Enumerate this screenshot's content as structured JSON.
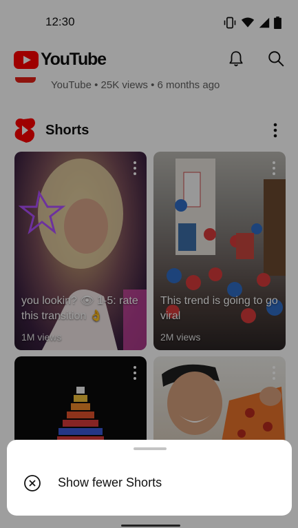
{
  "status_bar": {
    "time": "12:30",
    "icons": [
      "vibrate-icon",
      "wifi-icon",
      "signal-icon",
      "battery-icon"
    ]
  },
  "app_bar": {
    "logo_text": "YouTube",
    "brand_color": "#ff0000",
    "icons": [
      "notifications-bell-icon",
      "search-icon"
    ]
  },
  "previous_item": {
    "meta": "YouTube • 25K views • 6 months ago"
  },
  "shorts_shelf": {
    "title": "Shorts",
    "items": [
      {
        "caption": "you lookin? 👁 1-5: rate this transition 👌",
        "views": "1M views"
      },
      {
        "caption": "This trend is going to go viral",
        "views": "2M views"
      },
      {
        "caption": "",
        "views": ""
      },
      {
        "caption": "",
        "views": ""
      }
    ]
  },
  "bottom_sheet": {
    "options": [
      {
        "label": "Show fewer Shorts",
        "icon": "close-circle-icon"
      }
    ]
  }
}
